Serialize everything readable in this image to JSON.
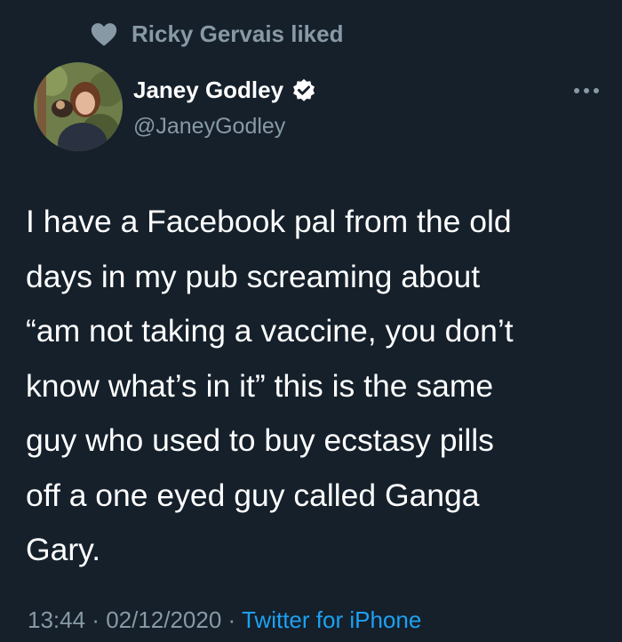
{
  "social_context": {
    "text": "Ricky Gervais liked",
    "icon": "heart-icon"
  },
  "tweet": {
    "author_name": "Janey Godley",
    "author_handle": "@JaneyGodley",
    "verified": true,
    "text": "I have a Facebook pal from the old\ndays in my pub screaming about\n“am not taking a vaccine, you don’t\nknow what’s in it” this is the same\nguy who used to buy ecstasy pills\noff a one eyed guy called Ganga\nGary.",
    "time": "13:44",
    "date": "02/12/2020",
    "separator": " · ",
    "source": "Twitter for iPhone"
  },
  "colors": {
    "background": "#15202b",
    "primary_text": "#ffffff",
    "secondary_text": "#8899a6",
    "accent": "#1da1f2"
  }
}
